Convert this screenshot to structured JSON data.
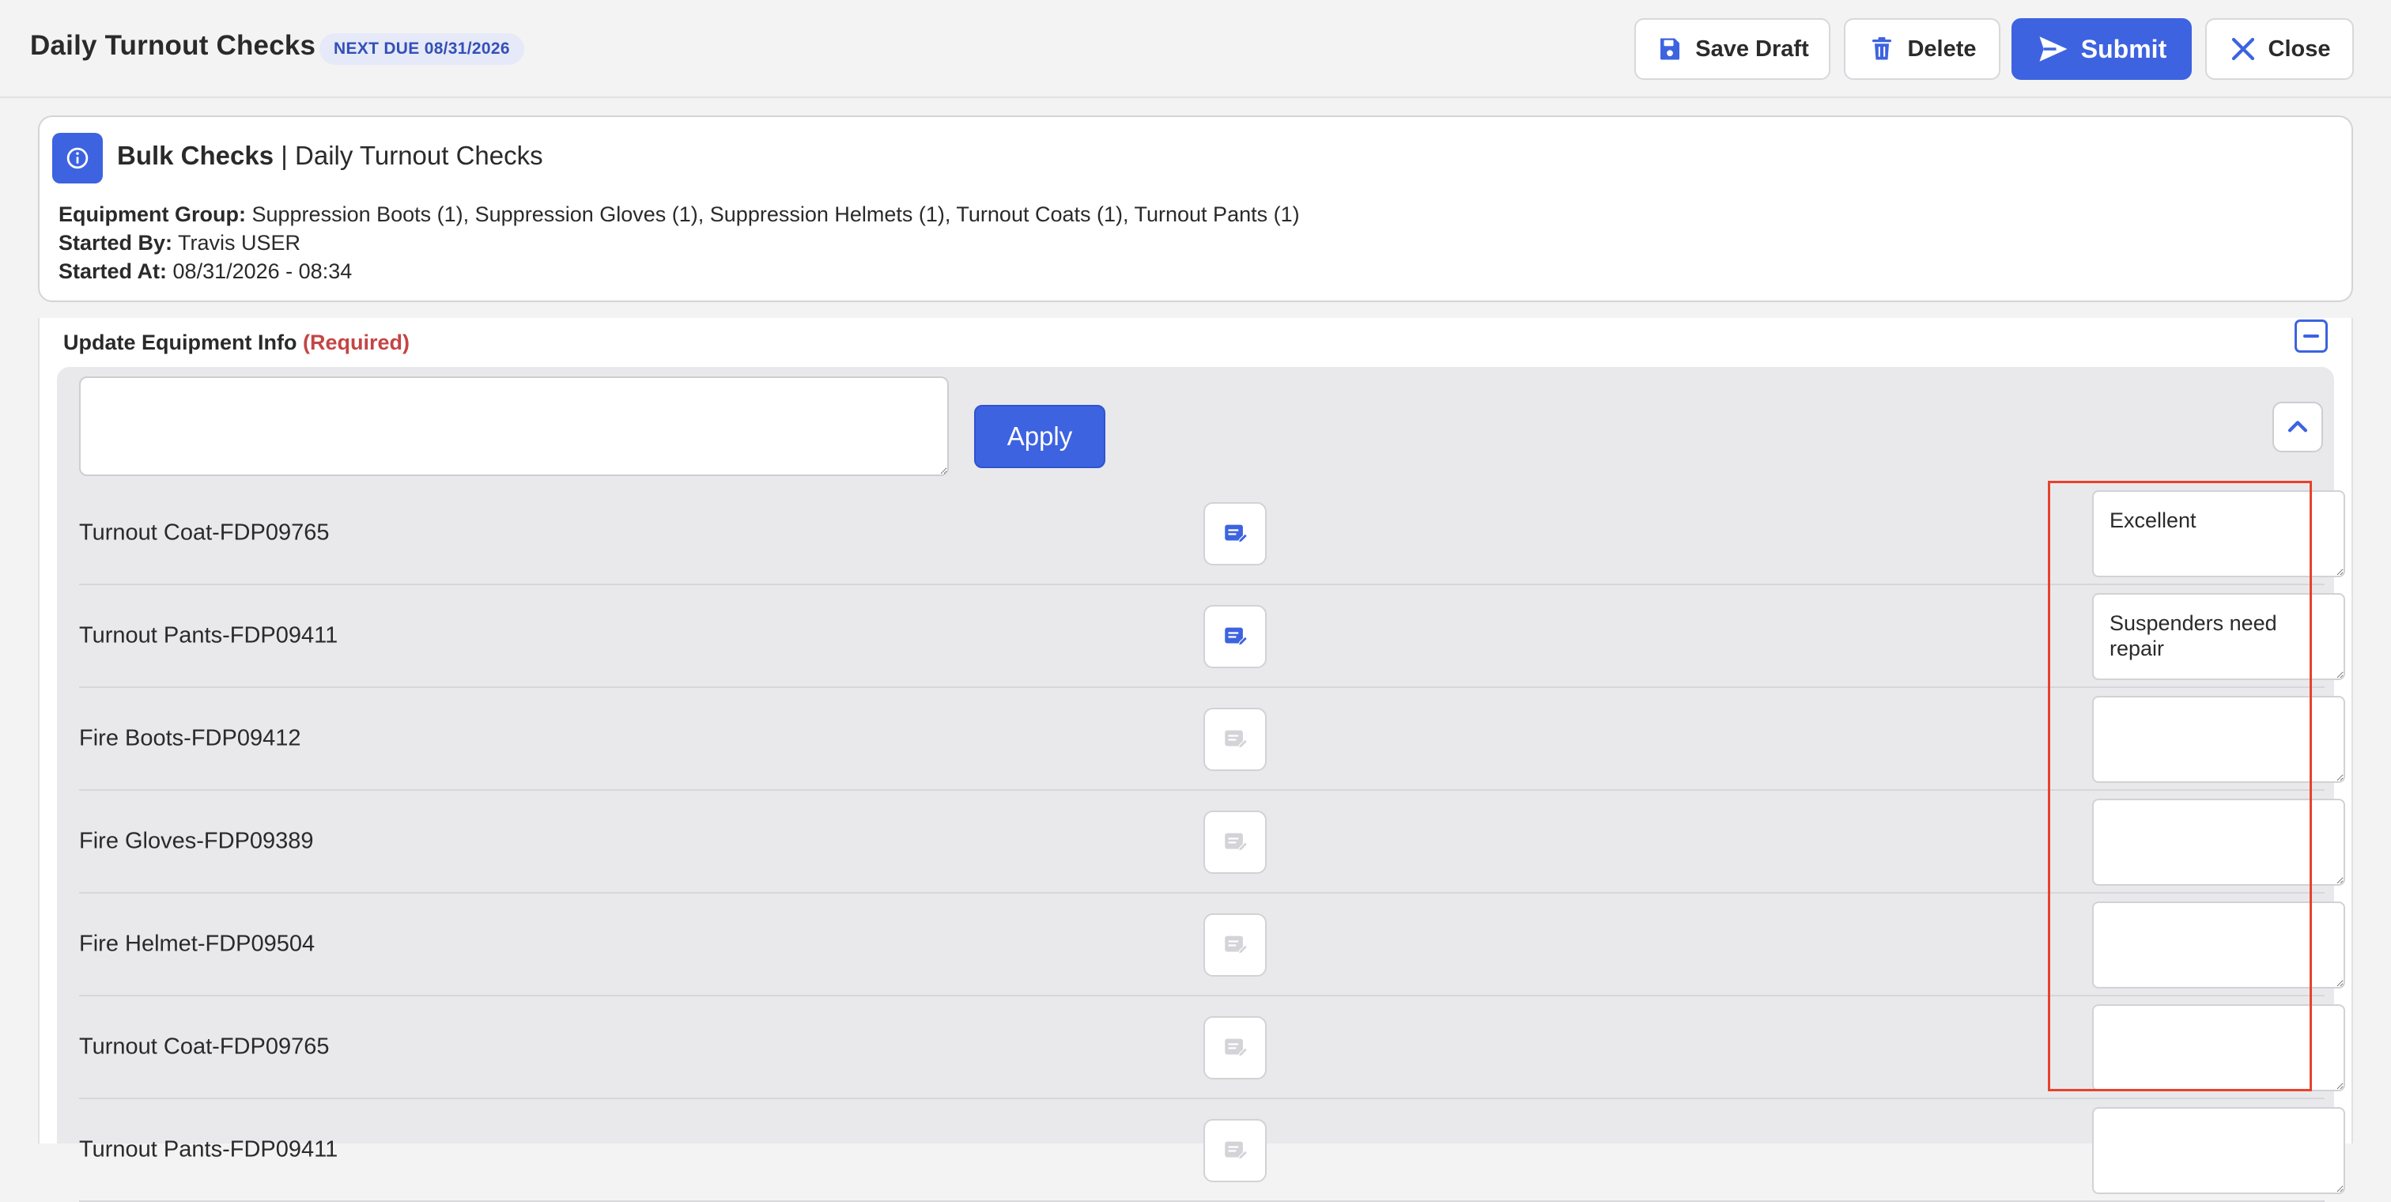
{
  "header": {
    "title": "Daily Turnout Checks",
    "due_badge": "NEXT DUE 08/31/2026",
    "save_draft_label": "Save Draft",
    "delete_label": "Delete",
    "submit_label": "Submit",
    "close_label": "Close"
  },
  "info_card": {
    "title_bold": "Bulk Checks",
    "title_rest": "| Daily Turnout Checks",
    "equipment_group_label": "Equipment Group:",
    "equipment_group_value": "Suppression Boots (1), Suppression Gloves (1), Suppression Helmets (1), Turnout Coats (1), Turnout Pants (1)",
    "started_by_label": "Started By:",
    "started_by_value": "Travis USER",
    "started_at_label": "Started At:",
    "started_at_value": "08/31/2026 - 08:34"
  },
  "section": {
    "title": "Update Equipment Info",
    "required_label": "(Required)",
    "apply_label": "Apply",
    "bulk_note_value": ""
  },
  "rows": [
    {
      "label": "Turnout Coat-FDP09765",
      "note": "Excellent",
      "has_note": true
    },
    {
      "label": "Turnout Pants-FDP09411",
      "note": "Suspenders need repair",
      "has_note": true
    },
    {
      "label": "Fire Boots-FDP09412",
      "note": "",
      "has_note": false
    },
    {
      "label": "Fire Gloves-FDP09389",
      "note": "",
      "has_note": false
    },
    {
      "label": "Fire Helmet-FDP09504",
      "note": "",
      "has_note": false
    },
    {
      "label": "Turnout Coat-FDP09765",
      "note": "",
      "has_note": false
    },
    {
      "label": "Turnout Pants-FDP09411",
      "note": "",
      "has_note": false
    }
  ],
  "colors": {
    "accent": "#3d63e0",
    "required": "#c44545",
    "highlight": "#e8412c"
  }
}
